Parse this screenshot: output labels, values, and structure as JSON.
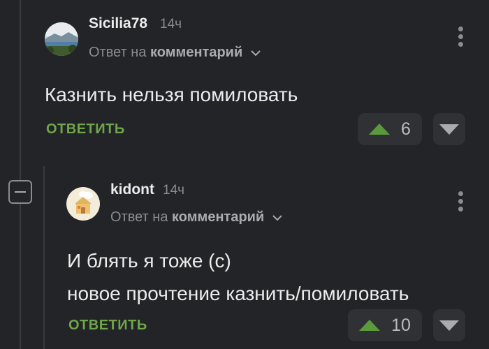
{
  "colors": {
    "background": "#222428",
    "accent_reply": "#6fa64a",
    "upvote": "#5a9a3b",
    "button_bg": "#2f3135"
  },
  "comments": [
    {
      "username": "Sicilia78",
      "time": "14ч",
      "reply_prefix": "Ответ на",
      "reply_target": "комментарий",
      "body": [
        "Казнить нельзя помиловать"
      ],
      "reply_label": "ОТВЕТИТЬ",
      "votes": "6",
      "avatar_icon": "landscape-avatar-icon"
    },
    {
      "username": "kidont",
      "time": "14ч",
      "reply_prefix": "Ответ на",
      "reply_target": "комментарий",
      "body": [
        "И блять я тоже (с)",
        "новое прочтение казнить/помиловать"
      ],
      "reply_label": "ОТВЕТИТЬ",
      "votes": "10",
      "avatar_icon": "house-avatar-icon"
    }
  ]
}
